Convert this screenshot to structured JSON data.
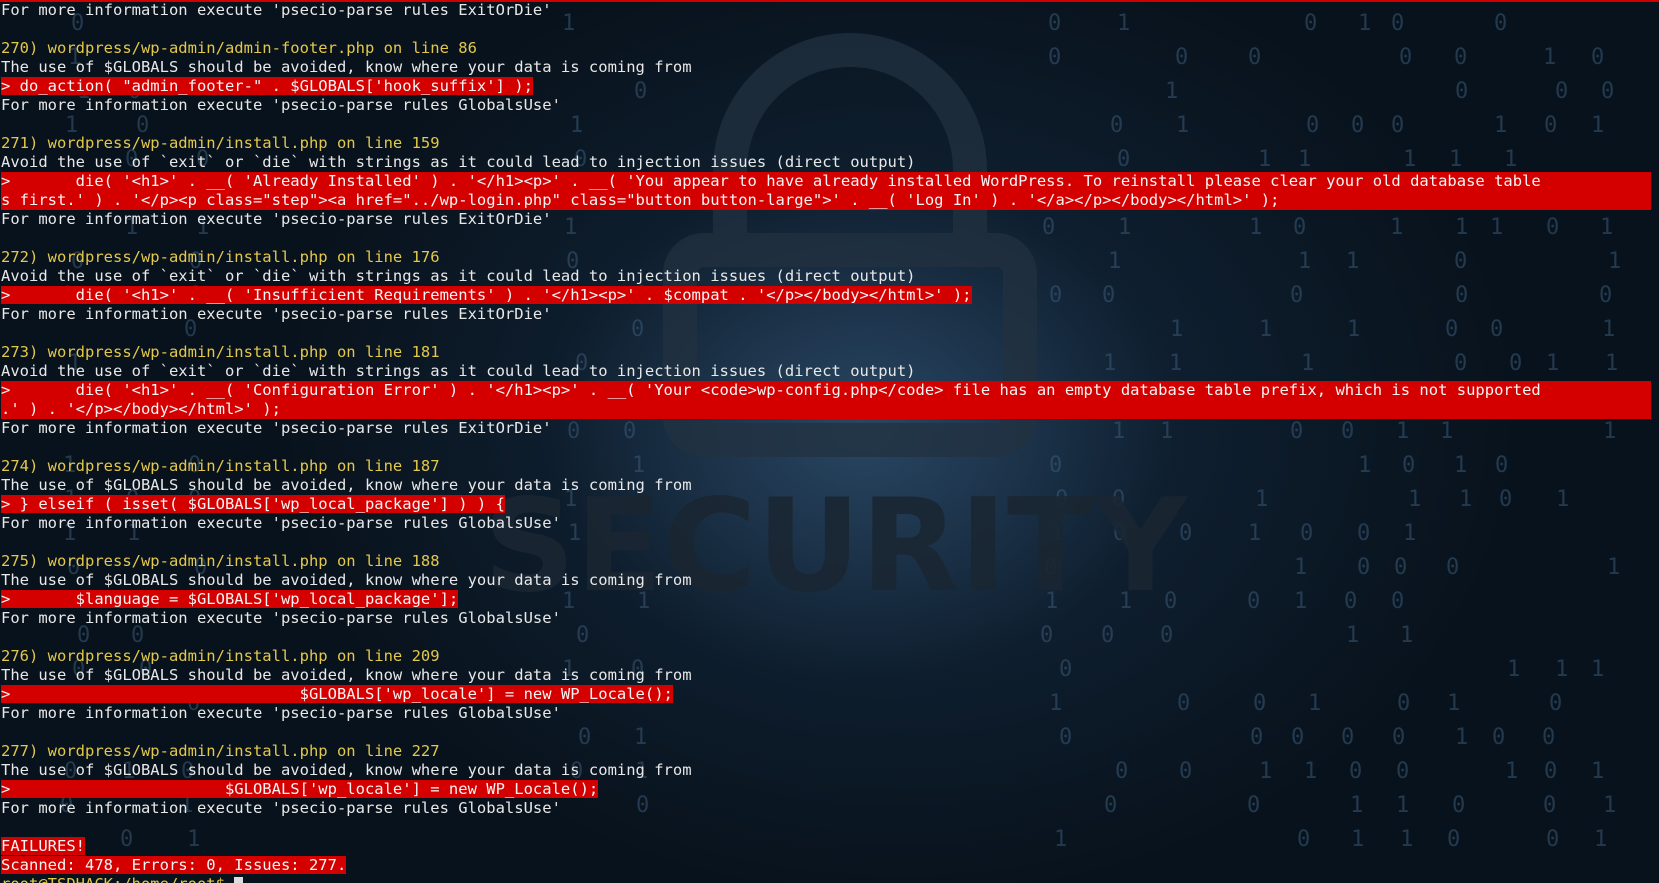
{
  "background": {
    "watermark_text": "SECURITY",
    "colors": {
      "base": "#0a1420",
      "glow": "#466e96",
      "watermark": "#16222c"
    }
  },
  "colors": {
    "highlight": "#d40000",
    "header": "#e3c84a",
    "text": "#e8e8e8"
  },
  "terminal": {
    "first_line": "For more information execute 'psecio-parse rules ExitOrDie'",
    "issues": [
      {
        "header": "270) wordpress/wp-admin/admin-footer.php on line 86",
        "message": "The use of $GLOBALS should be avoided, know where your data is coming from",
        "code": [
          "> do_action( \"admin_footer-\" . $GLOBALS['hook_suffix'] );"
        ],
        "info": "For more information execute 'psecio-parse rules GlobalsUse'"
      },
      {
        "header": "271) wordpress/wp-admin/install.php on line 159",
        "message": "Avoid the use of `exit` or `die` with strings as it could lead to injection issues (direct output)",
        "code": [
          ">       die( '<h1>' . __( 'Already Installed' ) . '</h1><p>' . __( 'You appear to have already installed WordPress. To reinstall please clear your old database table",
          "s first.' ) . '</p><p class=\"step\"><a href=\"../wp-login.php\" class=\"button button-large\">' . __( 'Log In' ) . '</a></p></body></html>' );"
        ],
        "info": "For more information execute 'psecio-parse rules ExitOrDie'"
      },
      {
        "header": "272) wordpress/wp-admin/install.php on line 176",
        "message": "Avoid the use of `exit` or `die` with strings as it could lead to injection issues (direct output)",
        "code": [
          ">       die( '<h1>' . __( 'Insufficient Requirements' ) . '</h1><p>' . $compat . '</p></body></html>' );"
        ],
        "info": "For more information execute 'psecio-parse rules ExitOrDie'"
      },
      {
        "header": "273) wordpress/wp-admin/install.php on line 181",
        "message": "Avoid the use of `exit` or `die` with strings as it could lead to injection issues (direct output)",
        "code": [
          ">       die( '<h1>' . __( 'Configuration Error' ) . '</h1><p>' . __( 'Your <code>wp-config.php</code> file has an empty database table prefix, which is not supported",
          ".' ) . '</p></body></html>' );"
        ],
        "info": "For more information execute 'psecio-parse rules ExitOrDie'"
      },
      {
        "header": "274) wordpress/wp-admin/install.php on line 187",
        "message": "The use of $GLOBALS should be avoided, know where your data is coming from",
        "code": [
          "> } elseif ( isset( $GLOBALS['wp_local_package'] ) ) {"
        ],
        "info": "For more information execute 'psecio-parse rules GlobalsUse'"
      },
      {
        "header": "275) wordpress/wp-admin/install.php on line 188",
        "message": "The use of $GLOBALS should be avoided, know where your data is coming from",
        "code": [
          ">       $language = $GLOBALS['wp_local_package'];"
        ],
        "info": "For more information execute 'psecio-parse rules GlobalsUse'"
      },
      {
        "header": "276) wordpress/wp-admin/install.php on line 209",
        "message": "The use of $GLOBALS should be avoided, know where your data is coming from",
        "code": [
          ">                               $GLOBALS['wp_locale'] = new WP_Locale();"
        ],
        "info": "For more information execute 'psecio-parse rules GlobalsUse'"
      },
      {
        "header": "277) wordpress/wp-admin/install.php on line 227",
        "message": "The use of $GLOBALS should be avoided, know where your data is coming from",
        "code": [
          ">                       $GLOBALS['wp_locale'] = new WP_Locale();"
        ],
        "info": "For more information execute 'psecio-parse rules GlobalsUse'"
      }
    ],
    "failures_label": "FAILURES!",
    "summary": "Scanned: 478, Errors: 0, Issues: 277.",
    "prompt": "root@TSDHACK:/home/root$ "
  }
}
